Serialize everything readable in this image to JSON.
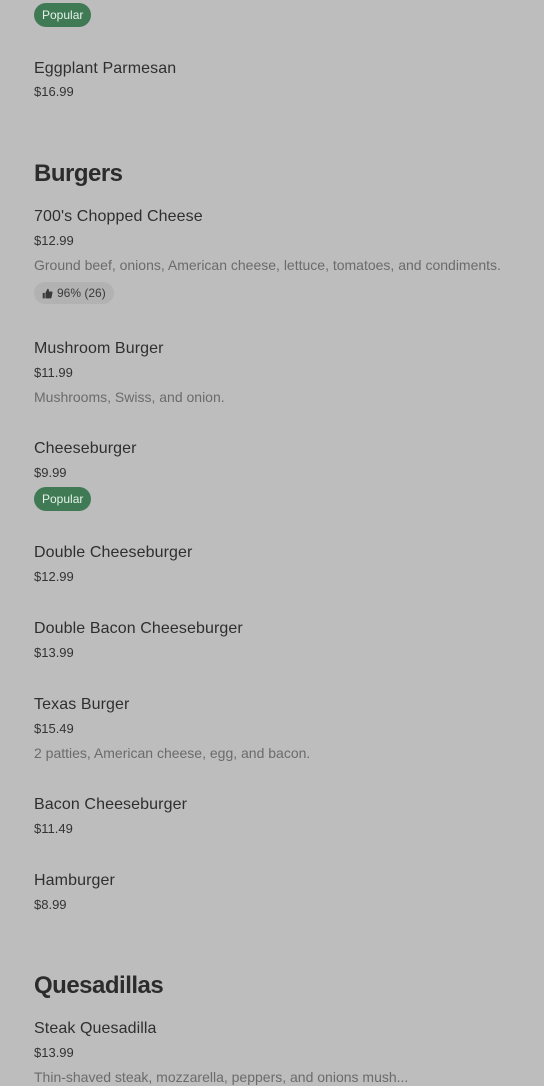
{
  "top_item": {
    "badge": "Popular",
    "name": "Eggplant Parmesan",
    "price": "$16.99"
  },
  "sections": {
    "burgers": {
      "title": "Burgers",
      "items": [
        {
          "name": "700's Chopped Cheese",
          "price": "$12.99",
          "description": "Ground beef, onions, American cheese, lettuce, tomatoes, and condiments.",
          "rating": "96% (26)"
        },
        {
          "name": "Mushroom Burger",
          "price": "$11.99",
          "description": "Mushrooms, Swiss, and onion."
        },
        {
          "name": "Cheeseburger",
          "price": "$9.99",
          "badge": "Popular"
        },
        {
          "name": "Double Cheeseburger",
          "price": "$12.99"
        },
        {
          "name": "Double Bacon Cheeseburger",
          "price": "$13.99"
        },
        {
          "name": "Texas Burger",
          "price": "$15.49",
          "description": "2 patties, American cheese, egg, and bacon."
        },
        {
          "name": "Bacon Cheeseburger",
          "price": "$11.49"
        },
        {
          "name": "Hamburger",
          "price": "$8.99"
        }
      ]
    },
    "quesadillas": {
      "title": "Quesadillas",
      "items": [
        {
          "name": "Steak Quesadilla",
          "price": "$13.99",
          "description": "Thin-shaved steak, mozzarella, peppers, and onions mush..."
        }
      ]
    }
  },
  "icons": {
    "rating": "thumbs-up-icon"
  },
  "colors": {
    "background": "#bdbdbd",
    "popular_badge": "#3f7a55"
  }
}
